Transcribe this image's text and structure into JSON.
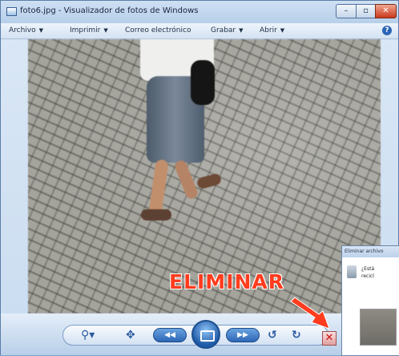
{
  "window": {
    "title": "foto6.jpg - Visualizador de fotos de Windows",
    "controls": {
      "minimize": "–",
      "maximize": "▫",
      "close": "✕"
    }
  },
  "menu": {
    "items": [
      {
        "label": "Archivo",
        "arrow": "▼"
      },
      {
        "label": "Imprimir",
        "arrow": "▼"
      },
      {
        "label": "Correo electrónico",
        "arrow": ""
      },
      {
        "label": "Grabar",
        "arrow": "▼"
      },
      {
        "label": "Abrir",
        "arrow": "▼"
      }
    ],
    "help": "?"
  },
  "toolbar": {
    "zoom": "⚲▾",
    "fit": "✥",
    "previous": "◀◀",
    "next": "▶▶",
    "rotate_left": "↺",
    "rotate_right": "↻",
    "delete": "✕"
  },
  "annotation": {
    "label": "ELIMINAR",
    "color": "#ff3c1e"
  },
  "dialog": {
    "title": "Eliminar archivo",
    "message": "¿Está\nrecicl"
  },
  "icons": {
    "app": "photo-viewer-icon",
    "help": "help-icon",
    "zoom": "zoom-icon",
    "fit": "actual-size-icon",
    "previous": "previous-icon",
    "slideshow": "slideshow-icon",
    "next": "next-icon",
    "rotate_left": "rotate-left-icon",
    "rotate_right": "rotate-right-icon",
    "delete": "delete-icon"
  }
}
